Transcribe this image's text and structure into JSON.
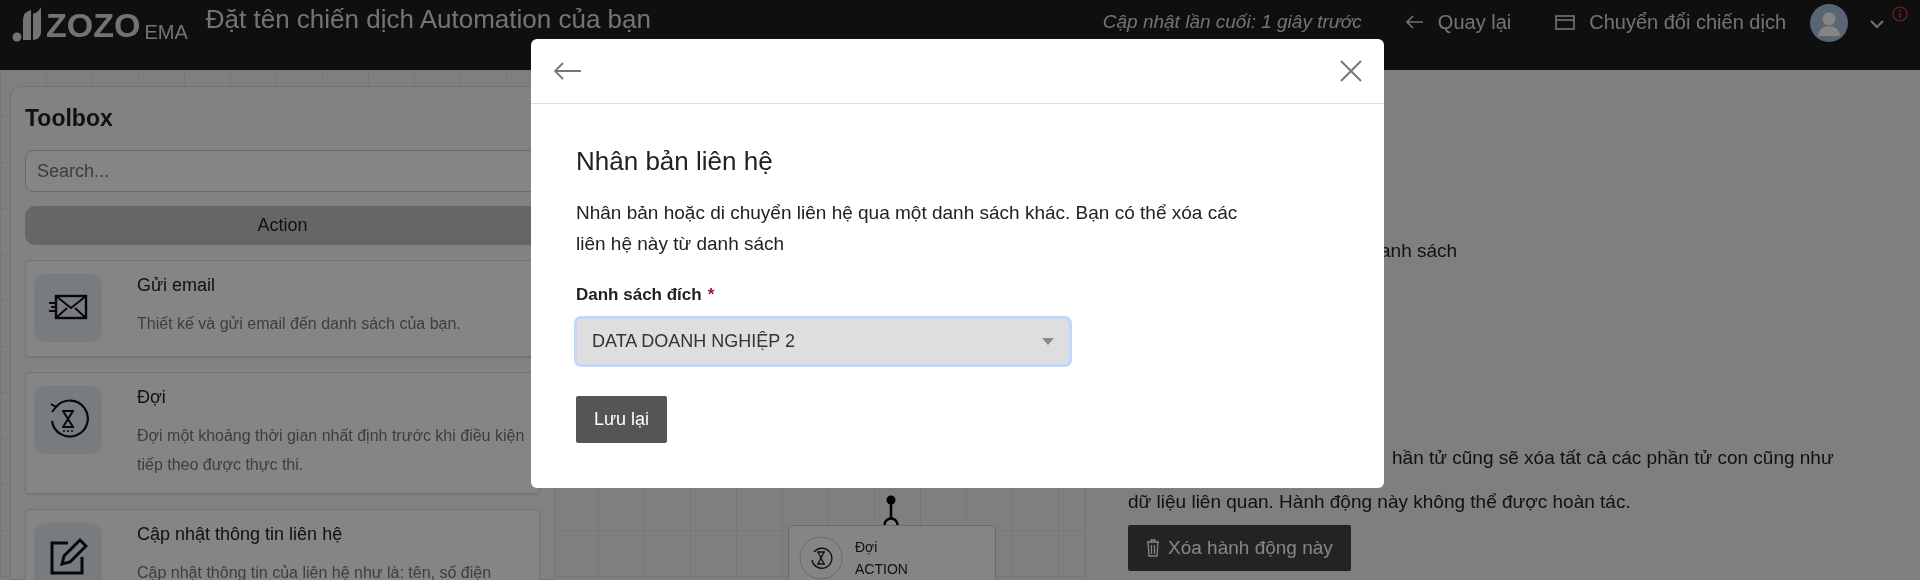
{
  "header": {
    "logo_text": "ZOZO",
    "logo_suffix": "EMA",
    "title": "Đặt tên chiến dịch Automation của bạn",
    "last_updated": "Cập nhật lần cuối: 1 giây trước",
    "back_link": "Quay lại",
    "switch_link": "Chuyển đổi chiến dịch"
  },
  "toolbox": {
    "title": "Toolbox",
    "search": {
      "placeholder": "Search..."
    },
    "tabs": [
      {
        "label": "Action",
        "selected": true
      }
    ],
    "items": [
      {
        "kind": "email",
        "title": "Gửi email",
        "description": "Thiết kế và gửi email đến danh sách của bạn."
      },
      {
        "kind": "wait",
        "title": "Đợi",
        "description": "Đợi một khoảng thời gian nhất định trước khi điều kiện tiếp theo được thực thi."
      },
      {
        "kind": "edit",
        "title": "Cập nhật thông tin liên hệ",
        "description": "Cập nhật thông tin của liên hệ như là: tên, số điện"
      }
    ]
  },
  "canvas": {
    "nodes": [
      {
        "kind": "wait",
        "title": "Đợi",
        "subtitle": "ACTION"
      }
    ]
  },
  "details": {
    "fragment": "anh sách",
    "warning_line_1": "hần tử cũng sẽ xóa tất cả các phần tử con cũng như",
    "warning_line_2": "dữ liệu liên quan. Hành động này không thể được hoàn tác.",
    "delete_button": "Xóa hành động này"
  },
  "modal": {
    "title": "Nhân bản liên hệ",
    "description": "Nhân bản hoặc di chuyển liên hệ qua một danh sách khác. Bạn có thể xóa các liên hệ này từ danh sách",
    "field": {
      "label": "Danh sách đích",
      "required_mark": "*",
      "value": "DATA DOANH NGHIỆP 2",
      "focused": true
    },
    "save_button": "Lưu lại"
  }
}
